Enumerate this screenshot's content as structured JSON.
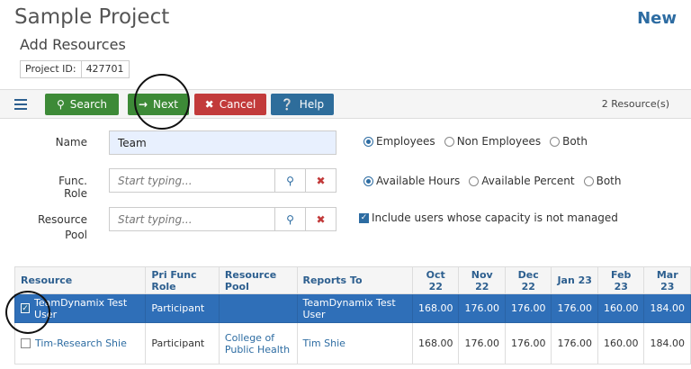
{
  "header": {
    "title": "Sample Project",
    "badge": "New",
    "subtitle": "Add Resources",
    "project_id_label": "Project ID:",
    "project_id_value": "427701"
  },
  "toolbar": {
    "search_label": "Search",
    "next_label": "Next",
    "cancel_label": "Cancel",
    "help_label": "Help",
    "resource_count": "2 Resource(s)"
  },
  "form": {
    "name_label": "Name",
    "name_value": "Team",
    "func_role_label": "Func. Role",
    "func_role_placeholder": "Start typing...",
    "resource_pool_label_1": "Resource",
    "resource_pool_label_2": "Pool",
    "resource_pool_placeholder": "Start typing...",
    "employee_options": [
      "Employees",
      "Non Employees",
      "Both"
    ],
    "employee_selected": "Employees",
    "availability_options": [
      "Available Hours",
      "Available Percent",
      "Both"
    ],
    "availability_selected": "Available Hours",
    "include_unmanaged_label": "Include users whose capacity is not managed",
    "include_unmanaged_checked": true
  },
  "grid": {
    "columns": [
      "Resource",
      "Pri Func Role",
      "Resource Pool",
      "Reports To",
      "Oct 22",
      "Nov 22",
      "Dec 22",
      "Jan 23",
      "Feb 23",
      "Mar 23"
    ],
    "rows": [
      {
        "selected": true,
        "resource": "TeamDynamix Test User",
        "role": "Participant",
        "pool": "",
        "reports_to": "TeamDynamix Test User",
        "months": [
          "168.00",
          "176.00",
          "176.00",
          "176.00",
          "160.00",
          "184.00"
        ]
      },
      {
        "selected": false,
        "resource": "Tim-Research Shie",
        "role": "Participant",
        "pool": "College of Public Health",
        "reports_to": "Tim Shie",
        "months": [
          "168.00",
          "176.00",
          "176.00",
          "176.00",
          "160.00",
          "184.00"
        ]
      }
    ]
  },
  "colors": {
    "primary_blue": "#2d6ca2",
    "success_green": "#3d8a37",
    "danger_red": "#c23a3a",
    "selected_row": "#2f6fb8"
  }
}
